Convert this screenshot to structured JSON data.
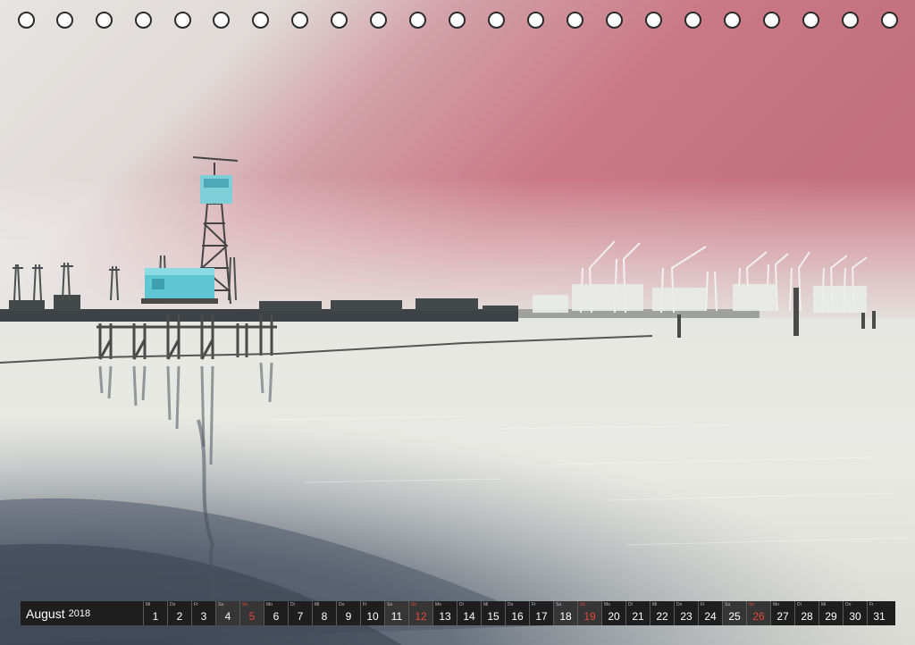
{
  "calendar": {
    "month": "August",
    "year": "2018",
    "days": [
      {
        "abbr": "Mi",
        "num": "1"
      },
      {
        "abbr": "Do",
        "num": "2"
      },
      {
        "abbr": "Fr",
        "num": "3"
      },
      {
        "abbr": "Sa",
        "num": "4"
      },
      {
        "abbr": "So",
        "num": "5"
      },
      {
        "abbr": "Mo",
        "num": "6"
      },
      {
        "abbr": "Di",
        "num": "7"
      },
      {
        "abbr": "Mi",
        "num": "8"
      },
      {
        "abbr": "Do",
        "num": "9"
      },
      {
        "abbr": "Fr",
        "num": "10"
      },
      {
        "abbr": "Sa",
        "num": "11"
      },
      {
        "abbr": "So",
        "num": "12"
      },
      {
        "abbr": "Mo",
        "num": "13"
      },
      {
        "abbr": "Di",
        "num": "14"
      },
      {
        "abbr": "Mi",
        "num": "15"
      },
      {
        "abbr": "Do",
        "num": "16"
      },
      {
        "abbr": "Fr",
        "num": "17"
      },
      {
        "abbr": "Sa",
        "num": "18"
      },
      {
        "abbr": "So",
        "num": "19"
      },
      {
        "abbr": "Mo",
        "num": "20"
      },
      {
        "abbr": "Di",
        "num": "21"
      },
      {
        "abbr": "Mi",
        "num": "22"
      },
      {
        "abbr": "Do",
        "num": "23"
      },
      {
        "abbr": "Fr",
        "num": "24"
      },
      {
        "abbr": "Sa",
        "num": "25"
      },
      {
        "abbr": "So",
        "num": "26"
      },
      {
        "abbr": "Mo",
        "num": "27"
      },
      {
        "abbr": "Di",
        "num": "28"
      },
      {
        "abbr": "Mi",
        "num": "29"
      },
      {
        "abbr": "Do",
        "num": "30"
      },
      {
        "abbr": "Fr",
        "num": "31"
      }
    ],
    "sunday_color": "#e4483a"
  },
  "colors": {
    "sky_pink": "#c97884",
    "sky_light": "#e3e1dc",
    "water": "#e8e8e2",
    "water_dark": "#4d5666",
    "booth_cyan": "#5fc7d4"
  }
}
